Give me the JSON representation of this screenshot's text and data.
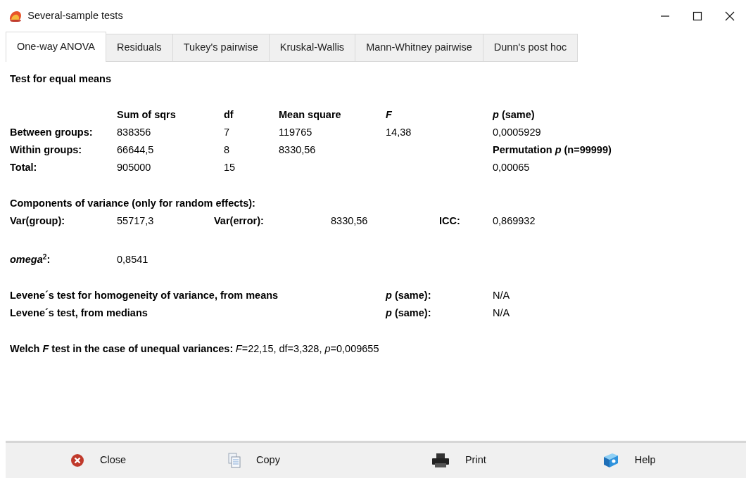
{
  "window": {
    "title": "Several-sample tests"
  },
  "tabs": [
    {
      "label": "One-way ANOVA",
      "selected": true
    },
    {
      "label": "Residuals",
      "selected": false
    },
    {
      "label": "Tukey's pairwise",
      "selected": false
    },
    {
      "label": "Kruskal-Wallis",
      "selected": false
    },
    {
      "label": "Mann-Whitney pairwise",
      "selected": false
    },
    {
      "label": "Dunn's post hoc",
      "selected": false
    }
  ],
  "report": {
    "heading": "Test for equal means",
    "anova_table": {
      "columns": [
        {
          "text": "Sum of sqrs",
          "italic": false
        },
        {
          "text": "df",
          "italic": false
        },
        {
          "text": "Mean square",
          "italic": false
        },
        {
          "text": "F",
          "italic": true
        },
        {
          "text": "*p* (same)",
          "italic": false
        }
      ],
      "rows": [
        {
          "label": "Between groups:",
          "cells": [
            {
              "text": "838356",
              "bold": false
            },
            {
              "text": "7",
              "bold": false
            },
            {
              "text": "119765",
              "bold": false
            },
            {
              "text": "14,38",
              "bold": false
            },
            {
              "text": "0,0005929",
              "bold": false
            }
          ]
        },
        {
          "label": "Within groups:",
          "cells": [
            {
              "text": "66644,5",
              "bold": false
            },
            {
              "text": "8",
              "bold": false
            },
            {
              "text": "8330,56",
              "bold": false
            },
            "",
            {
              "text": "Permutation *p* (n=99999)",
              "bold": true
            }
          ]
        },
        {
          "label": "Total:",
          "cells": [
            {
              "text": "905000",
              "bold": false
            },
            {
              "text": "15",
              "bold": false
            },
            "",
            "",
            {
              "text": "0,00065",
              "bold": false
            }
          ]
        }
      ]
    },
    "variance_components": {
      "heading": "Components of variance (only for random effects):",
      "items": [
        {
          "label": "Var(group):",
          "value": "55717,3"
        },
        {
          "label": "Var(error):",
          "value": "8330,56"
        },
        {
          "label": "ICC:",
          "value": "0,869932"
        }
      ]
    },
    "omega": {
      "label": "*omega*$^{2}$:",
      "value": "0,8541"
    },
    "levene": [
      {
        "label": "Levene´s test for homogeneity of variance, from means",
        "p_label": "*p* (same):",
        "value": "N/A"
      },
      {
        "label": "Levene´s test, from medians",
        "p_label": "*p* (same):",
        "value": "N/A"
      }
    ],
    "welch": {
      "label": "Welch *F* test in the case of unequal variances:",
      "result": "*F*=22,15, df=3,328, *p*=0,009655"
    }
  },
  "buttons": [
    {
      "kind": "close",
      "label": "Close"
    },
    {
      "kind": "copy",
      "label": "Copy"
    },
    {
      "kind": "print",
      "label": "Print"
    },
    {
      "kind": "help",
      "label": "Help"
    }
  ]
}
